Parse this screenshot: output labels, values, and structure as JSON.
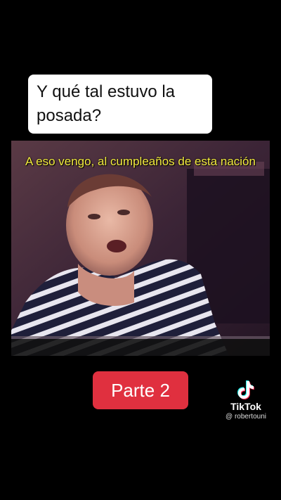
{
  "question": {
    "lines": [
      "Y qué tal estuvo la",
      "posada?"
    ]
  },
  "video": {
    "subtitle": "A eso vengo, al cumpleaños de esta nación"
  },
  "part_button": {
    "label": "Parte 2",
    "color": "#e0303f"
  },
  "watermark": {
    "icon": "tiktok-logo-icon",
    "brand": "TikTok",
    "handle": "@ robertouni"
  }
}
